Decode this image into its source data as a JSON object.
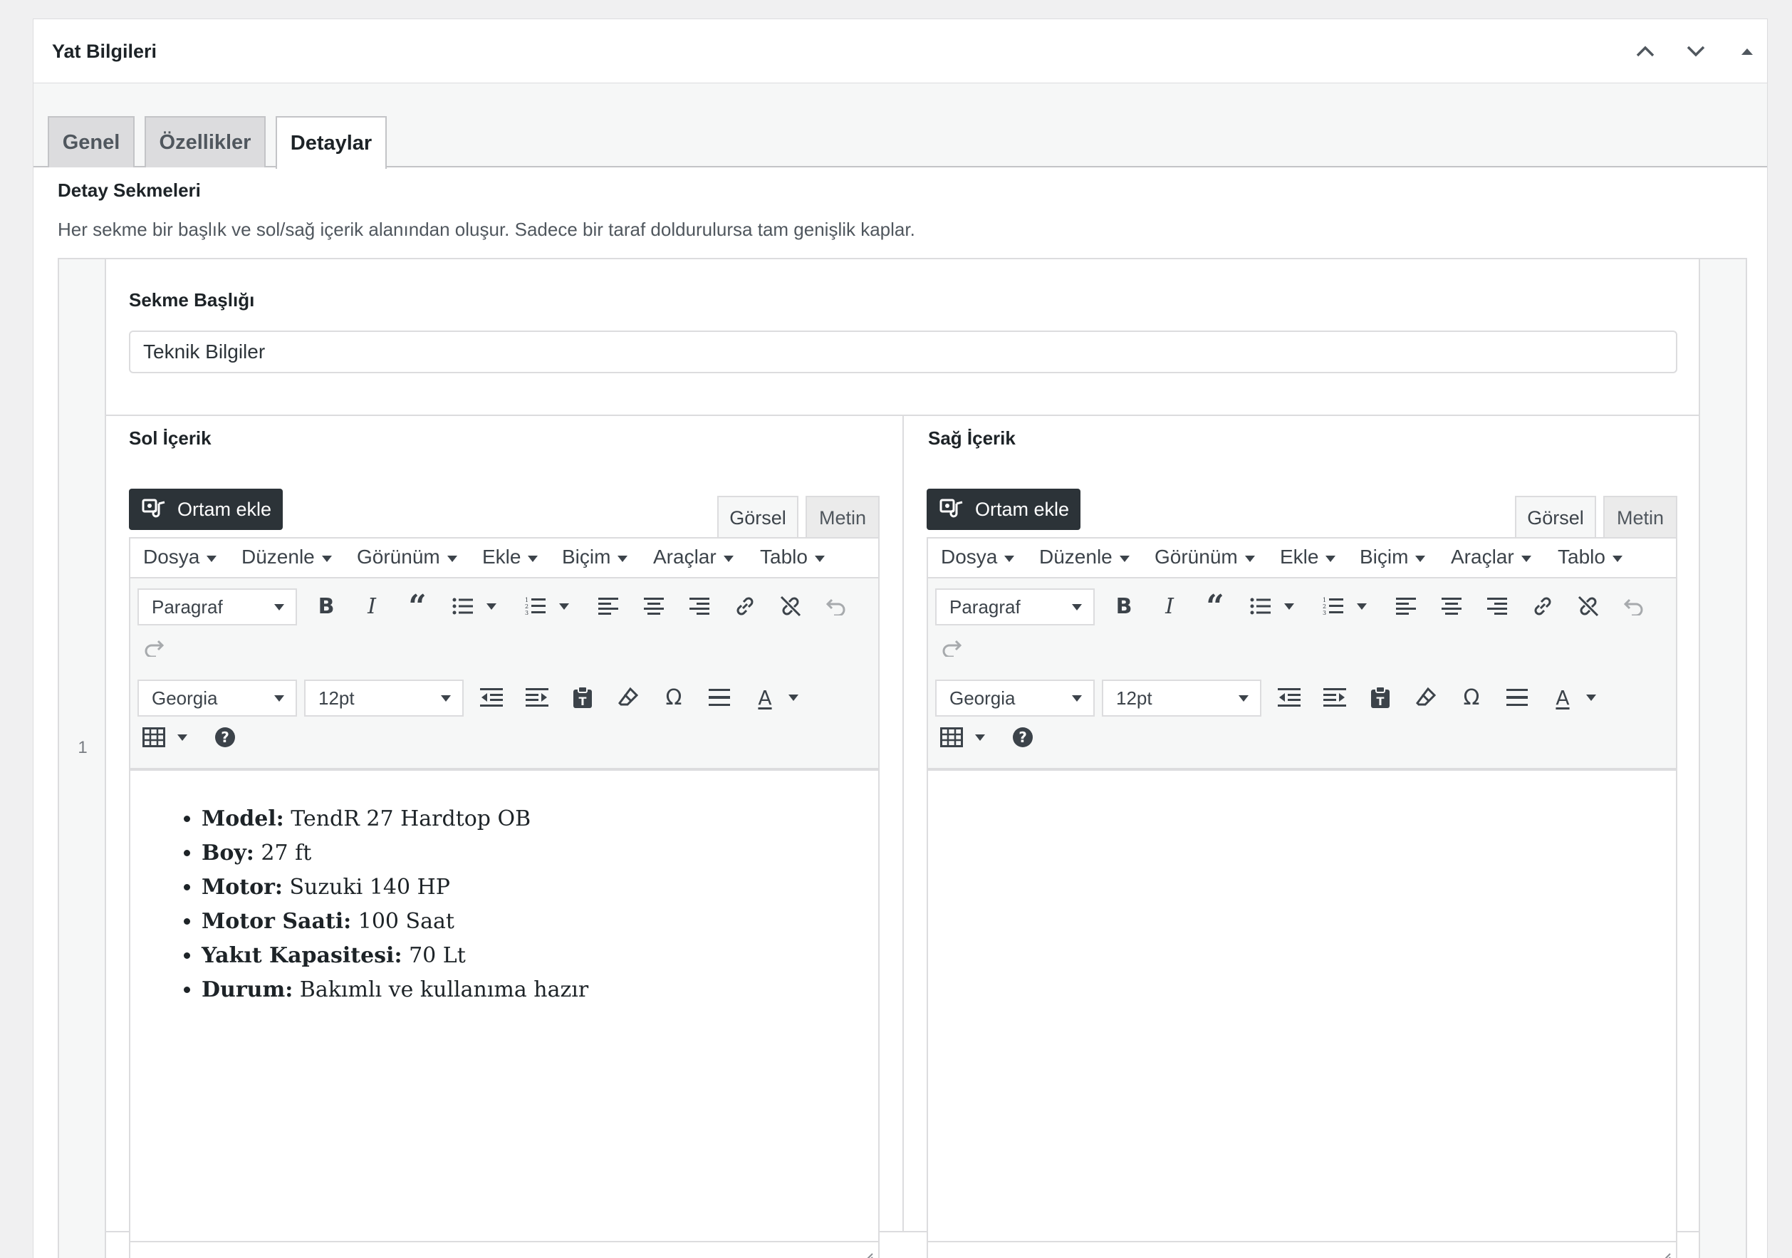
{
  "postbox": {
    "title": "Yat Bilgileri"
  },
  "tabs": [
    {
      "label": "Genel",
      "active": false
    },
    {
      "label": "Özellikler",
      "active": false
    },
    {
      "label": "Detaylar",
      "active": true
    }
  ],
  "section": {
    "title": "Detay Sekmeleri",
    "description": "Her sekme bir başlık ve sol/sağ içerik alanından oluşur. Sadece bir taraf doldurulursa tam genişlik kaplar."
  },
  "row": {
    "number": "1",
    "tab_title_label": "Sekme Başlığı",
    "tab_title_value": "Teknik Bilgiler"
  },
  "editors": {
    "left_label": "Sol İçerik",
    "right_label": "Sağ İçerik",
    "media_button": "Ortam ekle",
    "mode_visual": "Görsel",
    "mode_text": "Metin",
    "menu": [
      "Dosya",
      "Düzenle",
      "Görünüm",
      "Ekle",
      "Biçim",
      "Araçlar",
      "Tablo"
    ],
    "format_select": "Paragraf",
    "font_select": "Georgia",
    "size_select": "12pt"
  },
  "left_content": [
    {
      "key": "Model:",
      "value": " TendR 27 Hardtop OB"
    },
    {
      "key": "Boy:",
      "value": " 27 ft"
    },
    {
      "key": "Motor:",
      "value": " Suzuki 140 HP"
    },
    {
      "key": "Motor Saati:",
      "value": " 100 Saat"
    },
    {
      "key": "Yakıt Kapasitesi:",
      "value": " 70 Lt"
    },
    {
      "key": "Durum:",
      "value": " Bakımlı ve kullanıma hazır"
    }
  ],
  "icons": {
    "bold": "bold-icon",
    "italic": "italic-icon",
    "blockquote": "blockquote-icon",
    "bullist": "bullet-list-icon",
    "numlist": "numbered-list-icon",
    "alignleft": "align-left-icon",
    "aligncenter": "align-center-icon",
    "alignright": "align-right-icon",
    "link": "link-icon",
    "unlink": "unlink-icon",
    "undo": "undo-icon",
    "redo": "redo-icon",
    "outdent": "outdent-icon",
    "indent": "indent-icon",
    "paste": "paste-text-icon",
    "clear": "clear-formatting-icon",
    "omega": "special-character-icon",
    "hr": "horizontal-rule-icon",
    "textcolor": "text-color-icon",
    "table": "table-icon",
    "help": "help-icon"
  }
}
